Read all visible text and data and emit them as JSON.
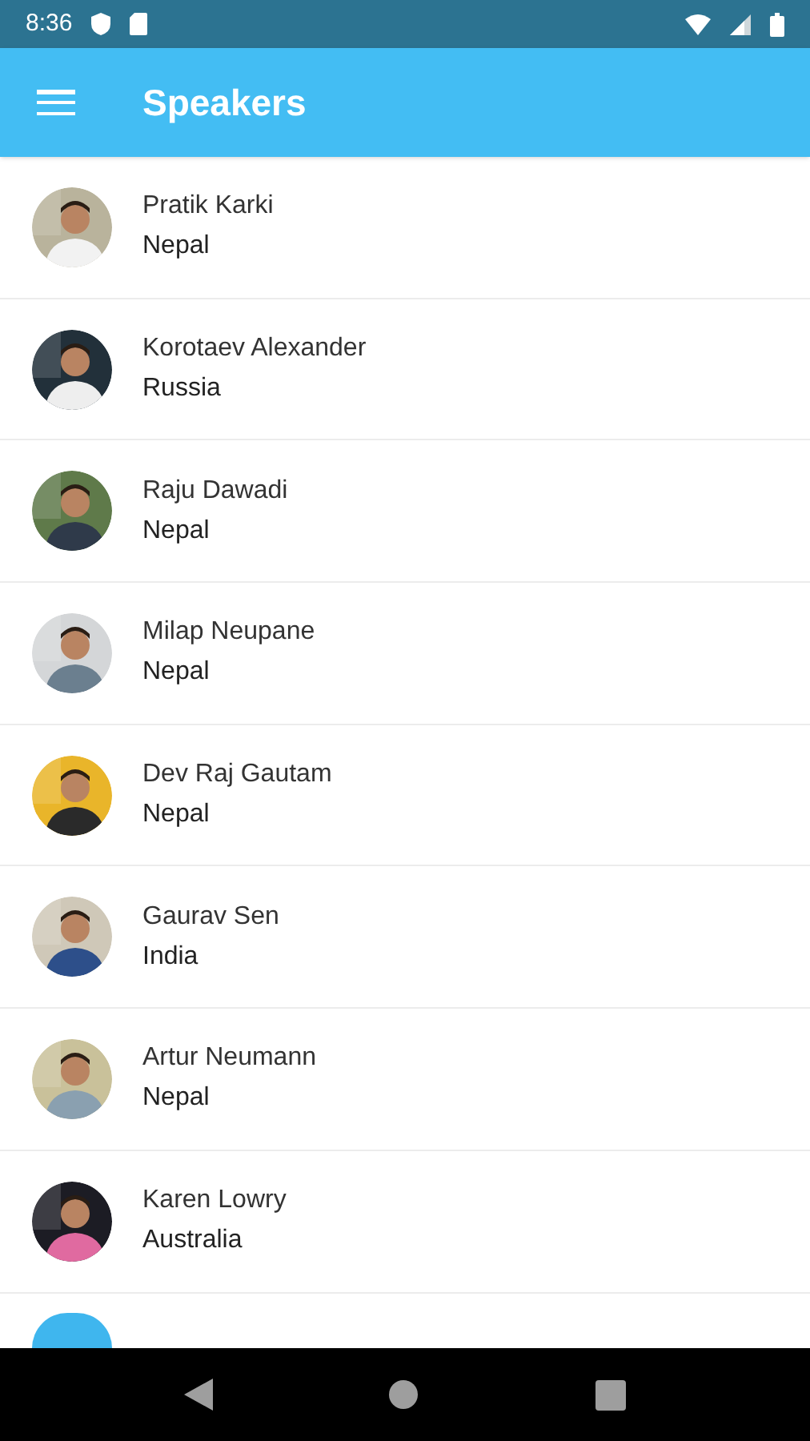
{
  "status_bar": {
    "time": "8:36"
  },
  "app_bar": {
    "title": "Speakers"
  },
  "speakers": [
    {
      "name": "Pratik Karki",
      "country": "Nepal"
    },
    {
      "name": "Korotaev Alexander",
      "country": "Russia"
    },
    {
      "name": "Raju Dawadi",
      "country": "Nepal"
    },
    {
      "name": "Milap Neupane",
      "country": "Nepal"
    },
    {
      "name": "Dev Raj Gautam",
      "country": "Nepal"
    },
    {
      "name": "Gaurav Sen",
      "country": "India"
    },
    {
      "name": "Artur Neumann",
      "country": "Nepal"
    },
    {
      "name": "Karen Lowry",
      "country": "Australia"
    },
    {
      "kind": "placeholder"
    }
  ]
}
